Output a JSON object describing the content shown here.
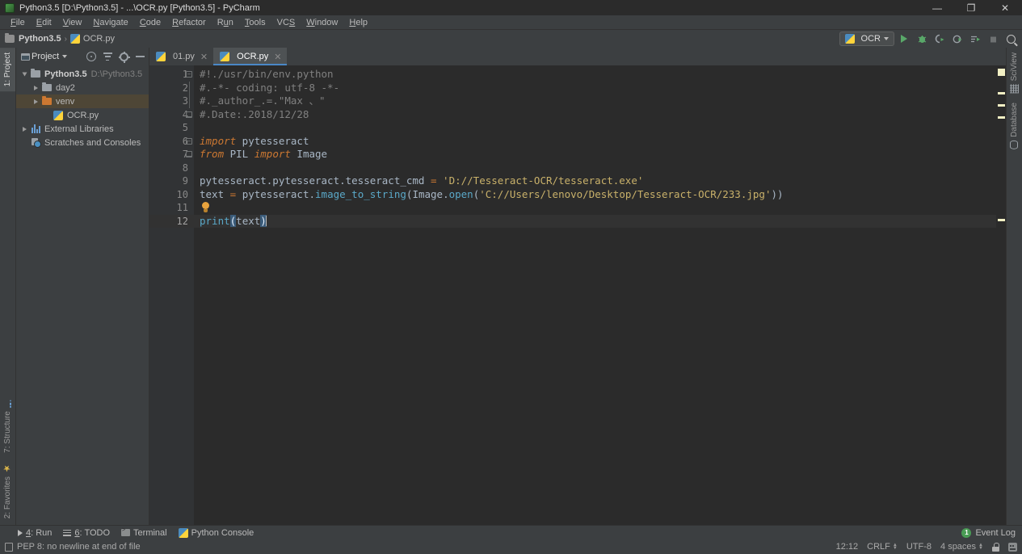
{
  "window": {
    "title": "Python3.5 [D:\\Python3.5] - ...\\OCR.py [Python3.5] - PyCharm",
    "icon": "pycharm-icon",
    "minimize": "—",
    "maximize": "❐",
    "close": "✕"
  },
  "menubar": [
    {
      "label": "File",
      "mnemonic": "F"
    },
    {
      "label": "Edit",
      "mnemonic": "E"
    },
    {
      "label": "View",
      "mnemonic": "V"
    },
    {
      "label": "Navigate",
      "mnemonic": "N"
    },
    {
      "label": "Code",
      "mnemonic": "C"
    },
    {
      "label": "Refactor",
      "mnemonic": "R"
    },
    {
      "label": "Run",
      "mnemonic": "u"
    },
    {
      "label": "Tools",
      "mnemonic": "T"
    },
    {
      "label": "VCS",
      "mnemonic": "S"
    },
    {
      "label": "Window",
      "mnemonic": "W"
    },
    {
      "label": "Help",
      "mnemonic": "H"
    }
  ],
  "breadcrumb": {
    "project": "Python3.5",
    "separator": "›",
    "file": "OCR.py"
  },
  "toolbar": {
    "run_config": "OCR",
    "icons": [
      "run-icon",
      "debug-icon",
      "run-coverage-icon",
      "profile-icon",
      "run-with-console-icon",
      "stop-icon",
      "search-everywhere-icon"
    ]
  },
  "project_panel": {
    "title": "Project",
    "header_icons": [
      "locate-icon",
      "collapse-all-icon",
      "settings-icon",
      "hide-icon"
    ],
    "tree": [
      {
        "label": "Python3.5",
        "detail": "D:\\Python3.5",
        "icon": "folder-icon",
        "depth": 0,
        "arrow": "open",
        "bold": true,
        "selected": false
      },
      {
        "label": "day2",
        "detail": "",
        "icon": "folder-icon",
        "depth": 1,
        "arrow": "closed",
        "bold": false,
        "selected": false
      },
      {
        "label": "venv",
        "detail": "",
        "icon": "folder-orange-icon",
        "depth": 1,
        "arrow": "closed",
        "bold": false,
        "selected": true
      },
      {
        "label": "OCR.py",
        "detail": "",
        "icon": "python-file-icon",
        "depth": 2,
        "arrow": "none",
        "bold": false,
        "selected": false
      },
      {
        "label": "External Libraries",
        "detail": "",
        "icon": "library-icon",
        "depth": 0,
        "arrow": "closed",
        "bold": false,
        "selected": false
      },
      {
        "label": "Scratches and Consoles",
        "detail": "",
        "icon": "scratches-icon",
        "depth": 0,
        "arrow": "none",
        "bold": false,
        "selected": false
      }
    ]
  },
  "left_rail": {
    "top": {
      "label": "1: Project",
      "active": true
    },
    "bottom": [
      {
        "label": "7: Structure",
        "icon": "structure-icon"
      },
      {
        "label": "2: Favorites",
        "icon": "star-icon"
      }
    ]
  },
  "right_rail": [
    {
      "label": "SciView",
      "icon": "grid-icon"
    },
    {
      "label": "Database",
      "icon": "database-icon"
    }
  ],
  "editor": {
    "tabs": [
      {
        "label": "01.py",
        "icon": "python-file-icon",
        "active": false,
        "close": "✕"
      },
      {
        "label": "OCR.py",
        "icon": "python-file-icon",
        "active": true,
        "close": "✕"
      }
    ],
    "line_numbers": [
      "1",
      "2",
      "3",
      "4",
      "5",
      "6",
      "7",
      "8",
      "9",
      "10",
      "11",
      "12"
    ],
    "current_line": 12,
    "lines": [
      "#!./usr/bin/env.python",
      "#.-*- coding: utf-8 -*-",
      "#._author_.=.\"Max 、\"",
      "#.Date:.2018/12/28",
      "",
      "import pytesseract",
      "from PIL import Image",
      "",
      "pytesseract.pytesseract.tesseract_cmd = 'D://Tesseract-OCR/tesseract.exe'",
      "text = pytesseract.image_to_string(Image.open('C://Users/lenovo/Desktop/Tesseract-OCR/233.jpg'))",
      "",
      "print(text)"
    ],
    "tokens": {
      "comment1": "#!./usr/bin/env.python",
      "comment2": "#.-*- coding: utf-8 -*-",
      "comment3": "#._author_.=.\"Max 、\"",
      "comment4": "#.Date:.2018/12/28",
      "kw_import": "import",
      "mod_pytesseract": " pytesseract",
      "kw_from": "from",
      "mod_pil": " PIL ",
      "kw_import2": "import",
      "mod_image": " Image",
      "l9_target": "pytesseract.pytesseract.tesseract_cmd ",
      "l9_eq": "=",
      "l9_str": " 'D://Tesseract-OCR/tesseract.exe'",
      "l10_var": "text ",
      "l10_eq": "=",
      "l10_obj": " pytesseract.",
      "l10_fn": "image_to_string",
      "l10_p1": "(",
      "l10_img": "Image.",
      "l10_open": "open",
      "l10_p2": "(",
      "l10_str": "'C://Users/lenovo/Desktop/Tesseract-OCR/233.jpg'",
      "l10_close": "))",
      "l12_fn": "print",
      "l12_p1": "(",
      "l12_arg": "text",
      "l12_p2": ")"
    },
    "intention_bulb": "lightbulb-icon"
  },
  "tool_windows": [
    {
      "label": "4: Run",
      "mnemonic": "4",
      "icon": "run-icon"
    },
    {
      "label": "6: TODO",
      "mnemonic": "6",
      "icon": "todo-icon"
    },
    {
      "label": "Terminal",
      "mnemonic": "",
      "icon": "terminal-icon"
    },
    {
      "label": "Python Console",
      "mnemonic": "",
      "icon": "python-console-icon"
    }
  ],
  "event_log": {
    "label": "Event Log",
    "count": "1"
  },
  "status_bar": {
    "message": "PEP 8: no newline at end of file",
    "message_icon": "inspection-icon",
    "caret_position": "12:12",
    "line_separator": "CRLF",
    "encoding": "UTF-8",
    "indent": "4 spaces",
    "lock_icon": "lock-icon",
    "ide_icon": "robot-icon"
  },
  "colors": {
    "chrome": "#3c3f41",
    "editor_bg": "#2b2b2b",
    "gutter_bg": "#313335",
    "accent_blue": "#4a88c7",
    "selection_orange": "#4e4636",
    "green_run": "#59a869",
    "marker_yellow": "#f2f0c4"
  }
}
